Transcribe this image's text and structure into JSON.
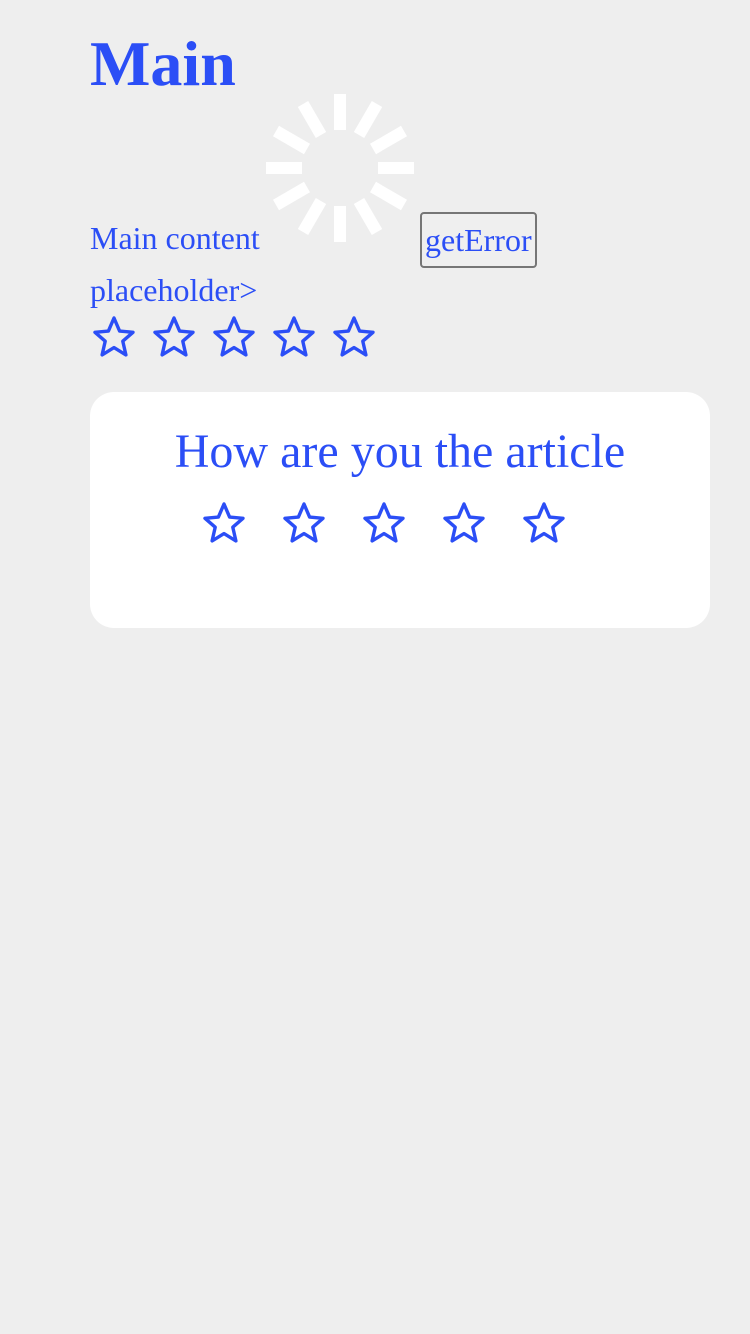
{
  "header": {
    "title": "Main"
  },
  "loader": {
    "icon": "loading-spinner-icon",
    "color": "#ffffff"
  },
  "main": {
    "content_placeholder": "Main content placeholder>",
    "error_button_label": "getError"
  },
  "rating": {
    "max_stars": 5,
    "selected": 0,
    "icon": "star-outline-icon"
  },
  "feedback_card": {
    "title": "How are you the article",
    "max_stars": 5,
    "selected": 0,
    "icon": "star-outline-icon"
  },
  "colors": {
    "accent": "#2b4ef6",
    "background": "#eeeeee",
    "card": "#ffffff"
  }
}
